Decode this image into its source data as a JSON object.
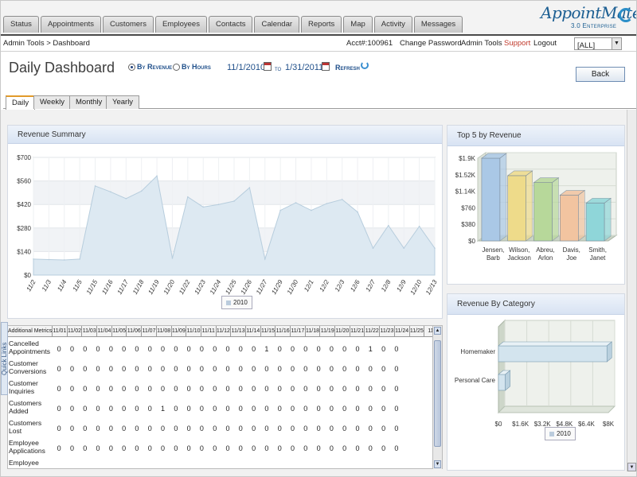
{
  "nav": {
    "tabs": [
      "Status",
      "Appointments",
      "Customers",
      "Employees",
      "Contacts",
      "Calendar",
      "Reports",
      "Map",
      "Activity",
      "Messages"
    ],
    "logo_main": "AppointMate",
    "logo_sub": "3.0 Enterprise"
  },
  "header": {
    "breadcrumb": "Admin Tools > Dashboard",
    "account": "Acct#:100961",
    "change_password": "Change Password",
    "admin_tools": "Admin Tools",
    "support": "Support",
    "logout": "Logout",
    "filter_value": "[ALL]"
  },
  "page": {
    "title": "Daily Dashboard",
    "by_revenue": "By Revenue",
    "by_hours": "By Hours",
    "start_date": "11/1/2010",
    "to_label": "to",
    "end_date": "1/31/2011",
    "refresh": "Refresh",
    "back": "Back",
    "subtabs": [
      "Daily",
      "Weekly",
      "Monthly",
      "Yearly"
    ]
  },
  "revenue_summary": {
    "title": "Revenue Summary",
    "legend": "2010"
  },
  "top5": {
    "title": "Top 5 by Revenue"
  },
  "category": {
    "title": "Revenue By Category",
    "legend": "2010"
  },
  "chart_data": [
    {
      "type": "area",
      "title": "Revenue Summary",
      "x": [
        "11/2",
        "11/3",
        "11/4",
        "11/5",
        "11/15",
        "11/16",
        "11/17",
        "11/18",
        "11/19",
        "11/20",
        "11/22",
        "11/23",
        "11/24",
        "11/25",
        "11/26",
        "11/27",
        "11/29",
        "11/30",
        "12/1",
        "12/2",
        "12/3",
        "12/6",
        "12/7",
        "12/8",
        "12/9",
        "12/10",
        "12/13"
      ],
      "series": [
        {
          "name": "2010",
          "values": [
            95,
            92,
            90,
            95,
            530,
            495,
            455,
            500,
            590,
            100,
            465,
            405,
            420,
            440,
            520,
            95,
            385,
            430,
            385,
            425,
            450,
            375,
            160,
            295,
            160,
            290,
            160
          ]
        }
      ],
      "y_ticks": [
        "$700",
        "$560",
        "$420",
        "$280",
        "$140",
        "$0"
      ],
      "ylim": [
        0,
        700
      ],
      "legend_position": "bottom"
    },
    {
      "type": "bar",
      "title": "Top 5 by Revenue",
      "categories": [
        "Jensen, Barb",
        "Wilson, Jackson",
        "Abreu, Arlon",
        "Davis, Joe",
        "Smith, Janet"
      ],
      "values": [
        1900,
        1500,
        1340,
        1050,
        870
      ],
      "colors": [
        "#aac8e6",
        "#eedb8a",
        "#b7d89a",
        "#f2c4a0",
        "#8fd6d9"
      ],
      "y_ticks": [
        "$1.9K",
        "$1.52K",
        "$1.14K",
        "$760",
        "$380",
        "$0"
      ],
      "ylim": [
        0,
        1900
      ]
    },
    {
      "type": "bar",
      "orientation": "horizontal",
      "title": "Revenue By Category",
      "categories": [
        "Homemaker",
        "Personal Care"
      ],
      "values": [
        7900,
        500
      ],
      "x_ticks": [
        "$0",
        "$1.6K",
        "$3.2K",
        "$4.8K",
        "$6.4K",
        "$8K"
      ],
      "xlim": [
        0,
        8000
      ],
      "series_name": "2010"
    }
  ],
  "metrics": {
    "header_label": "Additional Metrics",
    "dates": [
      "11/01",
      "11/02",
      "11/03",
      "11/04",
      "11/05",
      "11/06",
      "11/07",
      "11/08",
      "11/09",
      "11/10",
      "11/11",
      "11/12",
      "11/13",
      "11/14",
      "11/15",
      "11/16",
      "11/17",
      "11/18",
      "11/19",
      "11/20",
      "11/21",
      "11/22",
      "11/23",
      "11/24",
      "11/25",
      "11/"
    ],
    "rows": [
      {
        "label": "Cancelled Appointments",
        "values": [
          "0",
          "0",
          "0",
          "0",
          "0",
          "0",
          "0",
          "0",
          "0",
          "0",
          "0",
          "0",
          "0",
          "0",
          "0",
          "0",
          "1",
          "0",
          "0",
          "0",
          "0",
          "0",
          "0",
          "0",
          "1",
          "0",
          "0"
        ]
      },
      {
        "label": "Customer Conversions",
        "values": [
          "0",
          "0",
          "0",
          "0",
          "0",
          "0",
          "0",
          "0",
          "0",
          "0",
          "0",
          "0",
          "0",
          "0",
          "0",
          "0",
          "0",
          "0",
          "0",
          "0",
          "0",
          "0",
          "0",
          "0",
          "0",
          "0",
          "0"
        ]
      },
      {
        "label": "Customer Inquiries",
        "values": [
          "0",
          "0",
          "0",
          "0",
          "0",
          "0",
          "0",
          "0",
          "0",
          "0",
          "0",
          "0",
          "0",
          "0",
          "0",
          "0",
          "0",
          "0",
          "0",
          "0",
          "0",
          "0",
          "0",
          "0",
          "0",
          "0",
          "0"
        ]
      },
      {
        "label": "Customers Added",
        "values": [
          "0",
          "0",
          "0",
          "0",
          "0",
          "0",
          "0",
          "0",
          "1",
          "0",
          "0",
          "0",
          "0",
          "0",
          "0",
          "0",
          "0",
          "0",
          "0",
          "0",
          "0",
          "0",
          "0",
          "0",
          "0",
          "0",
          "0"
        ]
      },
      {
        "label": "Customers Lost",
        "values": [
          "0",
          "0",
          "0",
          "0",
          "0",
          "0",
          "0",
          "0",
          "0",
          "0",
          "0",
          "0",
          "0",
          "0",
          "0",
          "0",
          "0",
          "0",
          "0",
          "0",
          "0",
          "0",
          "0",
          "0",
          "0",
          "0",
          "0"
        ]
      },
      {
        "label": "Employee Applications",
        "values": [
          "0",
          "0",
          "0",
          "0",
          "0",
          "0",
          "0",
          "0",
          "0",
          "0",
          "0",
          "0",
          "0",
          "0",
          "0",
          "0",
          "0",
          "0",
          "0",
          "0",
          "0",
          "0",
          "0",
          "0",
          "0",
          "0",
          "0"
        ]
      },
      {
        "label": "Employee",
        "values": []
      }
    ],
    "quick_links": "Quick Links"
  }
}
